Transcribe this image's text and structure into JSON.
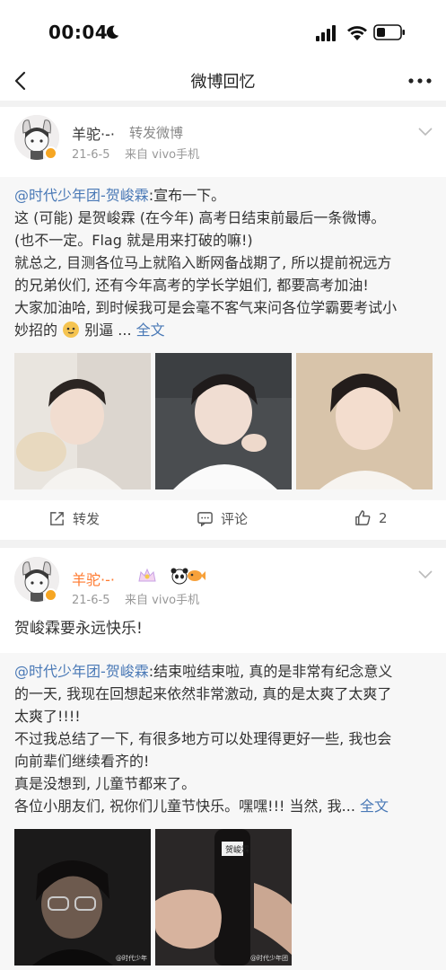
{
  "status_bar": {
    "time": "00:04"
  },
  "nav": {
    "title": "微博回忆"
  },
  "post1": {
    "username": "羊驼·-·",
    "action": "转发微博",
    "date": "21-6-5",
    "source": "来自 vivo手机",
    "original": {
      "mention": "@时代少年团-贺峻霖",
      "lines": [
        ":宣布一下。",
        "这 (可能) 是贺峻霖 (在今年) 高考日结束前最后一条微博。",
        "(也不一定。Flag 就是用来打破的嘛!)",
        "就总之, 目测各位马上就陷入断网备战期了, 所以提前祝远方",
        "的兄弟伙们, 还有今年高考的学长学姐们, 都要高考加油!",
        "大家加油哈, 到时候我可是会毫不客气来问各位学霸要考试小",
        "妙招的",
        "别逼 ... ",
        "全文"
      ]
    },
    "actions": {
      "repost": "转发",
      "comment": "评论",
      "like": "2"
    }
  },
  "post2": {
    "username": "羊驼·-·",
    "date": "21-6-5",
    "source": "来自 vivo手机",
    "text": "贺峻霖要永远快乐!",
    "original": {
      "mention": "@时代少年团-贺峻霖",
      "lines": [
        ":结束啦结束啦, 真的是非常有纪念意义",
        "的一天, 我现在回想起来依然非常激动, 真的是太爽了太爽了",
        "太爽了!!!!",
        "不过我总结了一下, 有很多地方可以处理得更好一些, 我也会",
        "向前辈们继续看齐的!",
        "真是没想到, 儿童节都来了。",
        "各位小朋友们, 祝你们儿童节快乐。嘿嘿!!! 当然, 我... ",
        "全文"
      ]
    },
    "photo_labels": [
      "贺峻霖"
    ],
    "watermarks": [
      "@时代少年",
      "@时代少年团"
    ]
  },
  "colors": {
    "link": "#4a79b6",
    "vip_name": "#ff7a2f",
    "badge": "#f6a623"
  }
}
